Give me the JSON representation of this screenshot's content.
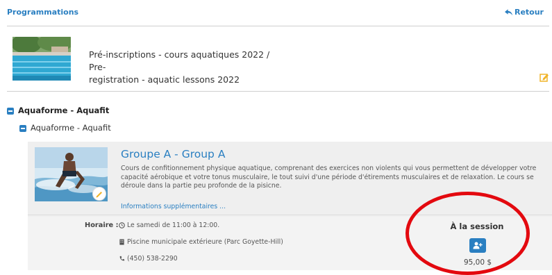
{
  "header": {
    "breadcrumb": "Programmations",
    "back_label": "Retour"
  },
  "program": {
    "title_line1": "Pré-inscriptions - cours aquatiques 2022 / Pre-",
    "title_line2": "registration - aquatic lessons 2022"
  },
  "tree": {
    "category": "Aquaforme - Aquafit",
    "subcategory": "Aquaforme - Aquafit"
  },
  "group": {
    "title": "Groupe A - Group A",
    "description": "Cours de confitionnement physique aquatique, comprenant des exercices non violents qui vous permettent de développer votre capacité aérobique et votre tonus musculaire, le tout suivi d'une période d'étirements musculaires et de relaxation. Le cours se déroule dans la partie peu profonde de la pisicne.",
    "more_info": "Informations supplémentaires ...",
    "schedule_label": "Horaire :",
    "schedule_time": "Le samedi de 11:00 à 12:00.",
    "location": "Piscine municipale extérieure (Parc Goyette-Hill)",
    "phone": "(450) 538-2290",
    "session_label": "À la session",
    "price": "95,00 $"
  },
  "colors": {
    "link": "#2a7fc1",
    "annotation": "#e3090f",
    "edit_icon": "#f0b429"
  }
}
